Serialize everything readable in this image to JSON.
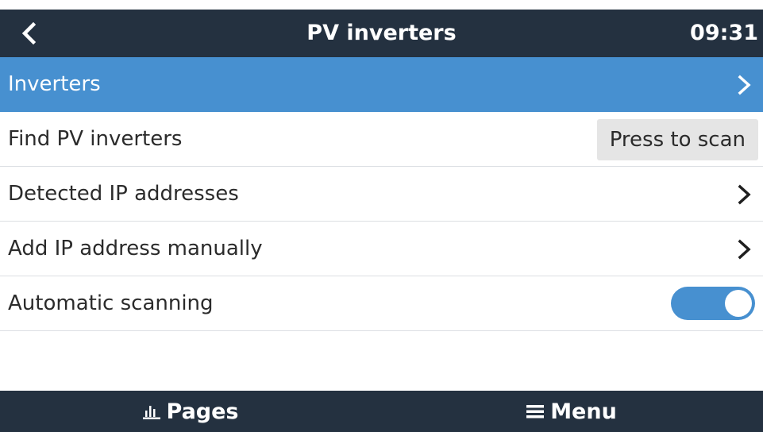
{
  "header": {
    "title": "PV inverters",
    "time": "09:31",
    "back_icon": "chevron-left-icon"
  },
  "list": {
    "items": [
      {
        "label": "Inverters",
        "control": "chevron",
        "selected": true
      },
      {
        "label": "Find PV inverters",
        "control": "button",
        "button_label": "Press to scan"
      },
      {
        "label": "Detected IP addresses",
        "control": "chevron"
      },
      {
        "label": "Add IP address manually",
        "control": "chevron"
      },
      {
        "label": "Automatic scanning",
        "control": "toggle",
        "toggle_on": true
      }
    ]
  },
  "footer": {
    "pages_label": "Pages",
    "pages_icon": "bar-chart-icon",
    "menu_label": "Menu",
    "menu_icon": "hamburger-menu-icon"
  },
  "colors": {
    "header_bg": "#243140",
    "accent": "#4790d0",
    "button_bg": "#e5e5e5",
    "text": "#2b2b2b"
  }
}
